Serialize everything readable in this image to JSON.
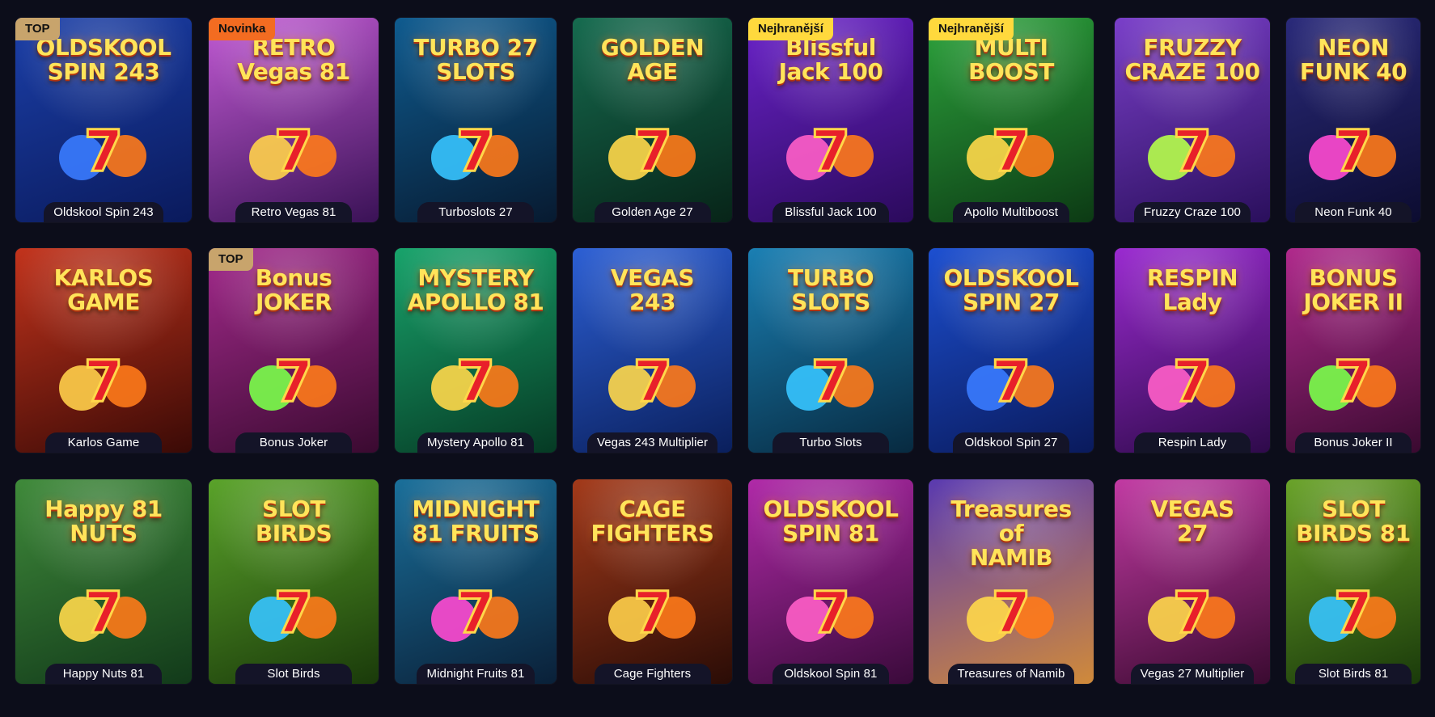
{
  "games": [
    {
      "name": "Oldskool Spin 243",
      "badge": "TOP",
      "logo": "OLDSKOOL\nSPIN 243",
      "bg": [
        "#1b3fa8",
        "#0a1a5c"
      ],
      "accent": "#3a7bff"
    },
    {
      "name": "Retro Vegas 81",
      "badge": "Novinka",
      "logo": "RETRO\nVegas 81",
      "bg": [
        "#c25ad4",
        "#3a1256"
      ],
      "accent": "#ffd24a"
    },
    {
      "name": "Turboslots 27",
      "badge": "",
      "logo": "TURBO 27\nSLOTS",
      "bg": [
        "#0f5b8f",
        "#071a30"
      ],
      "accent": "#36c4ff"
    },
    {
      "name": "Golden Age 27",
      "badge": "",
      "logo": "GOLDEN\nAGE",
      "bg": [
        "#166b4f",
        "#072418"
      ],
      "accent": "#ffd84a"
    },
    {
      "name": "Blissful Jack 100",
      "badge": "Nejhranější",
      "logo": "Blissful\nJack 100",
      "bg": [
        "#6a22c9",
        "#2b0a5c"
      ],
      "accent": "#ff5ec8"
    },
    {
      "name": "Apollo Multiboost",
      "badge": "Nejhranější",
      "logo": "MULTI\nBOOST",
      "bg": [
        "#2ca33c",
        "#0c3a14"
      ],
      "accent": "#ffd84a"
    },
    {
      "name": "Fruzzy Craze 100",
      "badge": "",
      "logo": "FRUZZY\nCRAZE 100",
      "bg": [
        "#7a3fc9",
        "#2a0f5c"
      ],
      "accent": "#b6ff4a"
    },
    {
      "name": "Neon Funk 40",
      "badge": "",
      "logo": "NEON\nFUNK 40",
      "bg": [
        "#2a2a7a",
        "#0c0c30"
      ],
      "accent": "#ff4ad2"
    },
    {
      "name": "Karlos Game",
      "badge": "",
      "logo": "KARLOS\nGAME",
      "bg": [
        "#c2331c",
        "#3a0a06"
      ],
      "accent": "#ffcf4a"
    },
    {
      "name": "Bonus Joker",
      "badge": "TOP",
      "logo": "Bonus\nJOKER",
      "bg": [
        "#a32a8c",
        "#3a0a30"
      ],
      "accent": "#7aff4a"
    },
    {
      "name": "Mystery Apollo 81",
      "badge": "",
      "logo": "MYSTERY\nAPOLLO 81",
      "bg": [
        "#18a36b",
        "#063a24"
      ],
      "accent": "#ffd84a"
    },
    {
      "name": "Vegas 243 Multiplier",
      "badge": "",
      "logo": "VEGAS\n243",
      "bg": [
        "#2c5fd4",
        "#0a1f5c"
      ],
      "accent": "#ffd84a"
    },
    {
      "name": "Turbo Slots",
      "badge": "",
      "logo": "TURBO\nSLOTS",
      "bg": [
        "#1a7fb3",
        "#072a40"
      ],
      "accent": "#36c4ff"
    },
    {
      "name": "Oldskool Spin 27",
      "badge": "",
      "logo": "OLDSKOOL\nSPIN 27",
      "bg": [
        "#1c4fd0",
        "#0a1a5c"
      ],
      "accent": "#3a7bff"
    },
    {
      "name": "Respin Lady",
      "badge": "",
      "logo": "RESPIN\nLady",
      "bg": [
        "#9a2ad0",
        "#2e0a4a"
      ],
      "accent": "#ff5ec8"
    },
    {
      "name": "Bonus Joker II",
      "badge": "",
      "logo": "BONUS\nJOKER II",
      "bg": [
        "#b02a8c",
        "#3a0a30"
      ],
      "accent": "#7aff4a"
    },
    {
      "name": "Happy Nuts 81",
      "badge": "",
      "logo": "Happy 81\nNUTS",
      "bg": [
        "#3f8a3a",
        "#123a1a"
      ],
      "accent": "#ffd84a"
    },
    {
      "name": "Slot Birds",
      "badge": "",
      "logo": "SLOT\nBIRDS",
      "bg": [
        "#5aa32a",
        "#1a3a0a"
      ],
      "accent": "#36c4ff"
    },
    {
      "name": "Midnight Fruits 81",
      "badge": "",
      "logo": "MIDNIGHT\n81 FRUITS",
      "bg": [
        "#1a6f9a",
        "#0a2038"
      ],
      "accent": "#ff4ad2"
    },
    {
      "name": "Cage Fighters",
      "badge": "",
      "logo": "CAGE\nFIGHTERS",
      "bg": [
        "#a33a1a",
        "#2a0c06"
      ],
      "accent": "#ffcf4a"
    },
    {
      "name": "Oldskool Spin 81",
      "badge": "",
      "logo": "OLDSKOOL\nSPIN 81",
      "bg": [
        "#b02aa8",
        "#3a0a3a"
      ],
      "accent": "#ff5ec8"
    },
    {
      "name": "Treasures of Namib",
      "badge": "",
      "logo": "Treasures of\nNAMIB",
      "bg": [
        "#5a3ab0",
        "#d08a3a"
      ],
      "accent": "#ffd84a"
    },
    {
      "name": "Vegas 27 Multiplier",
      "badge": "",
      "logo": "VEGAS\n27",
      "bg": [
        "#c23aa3",
        "#3a0a30"
      ],
      "accent": "#ffd84a"
    },
    {
      "name": "Slot Birds 81",
      "badge": "",
      "logo": "SLOT\nBIRDS 81",
      "bg": [
        "#6aa32a",
        "#1a3a0a"
      ],
      "accent": "#36c4ff"
    }
  ]
}
